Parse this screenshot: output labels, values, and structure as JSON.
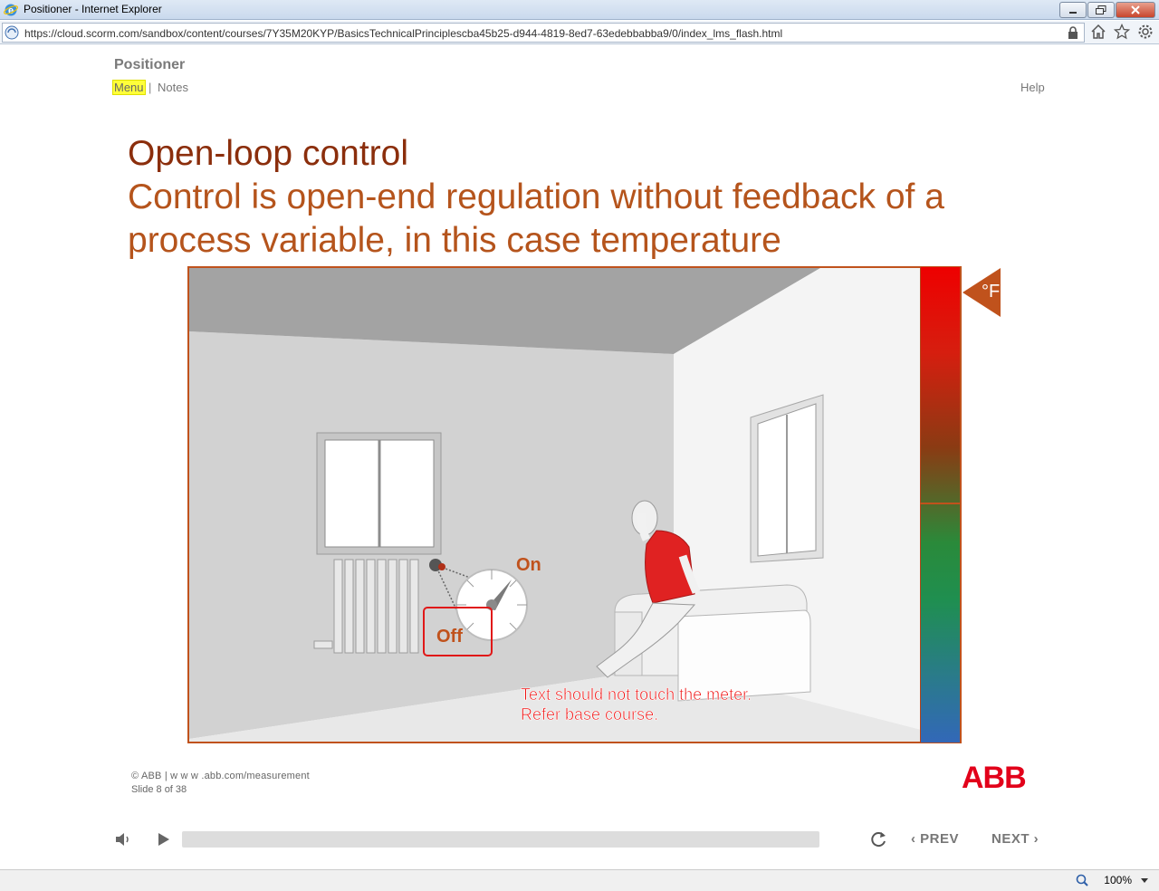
{
  "window": {
    "title": "Positioner - Internet Explorer",
    "url": "https://cloud.scorm.com/sandbox/content/courses/7Y35M20KYP/BasicsTechnicalPrinciplescba45b25-d944-4819-8ed7-63edebbabba9/0/index_lms_flash.html"
  },
  "course": {
    "title": "Positioner",
    "menu_label": "Menu",
    "separator": "|",
    "notes_label": "Notes",
    "help_label": "Help"
  },
  "slide": {
    "heading": "Open-loop control",
    "subheading": "Control is open-end regulation without feedback of a process variable, in this case temperature",
    "dial_on_label": "On",
    "dial_off_label": "Off",
    "temperature_unit": "°F",
    "note_line1": "Text should not touch the meter.",
    "note_line2": "Refer base course."
  },
  "footer": {
    "copyright": "© ABB | w w w .abb.com/measurement",
    "slide_counter": "Slide 8 of 38",
    "brand": "ABB"
  },
  "player": {
    "prev_label": "PREV",
    "next_label": "NEXT",
    "progress": 0.0
  },
  "status": {
    "zoom": "100%"
  },
  "colors": {
    "accent_dark": "#8b2e0c",
    "accent": "#b5541c",
    "abb_red": "#e2001a"
  }
}
